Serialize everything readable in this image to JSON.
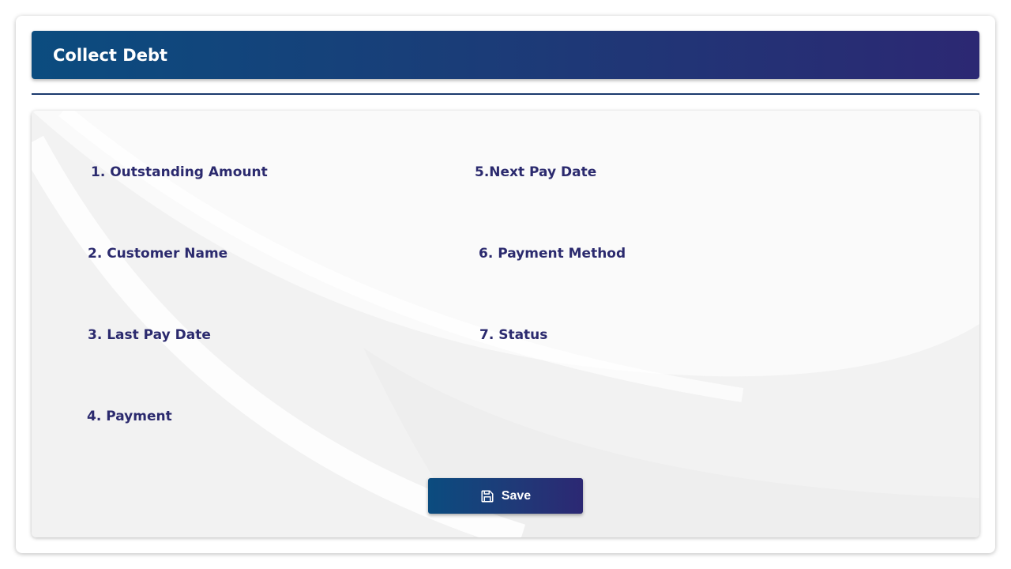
{
  "header": {
    "title": "Collect Debt"
  },
  "form": {
    "fields": [
      "1. Outstanding Amount",
      "2. Customer Name",
      "3. Last Pay Date",
      "4. Payment",
      "5.Next Pay Date",
      "6. Payment Method",
      "7. Status"
    ]
  },
  "actions": {
    "save_label": "Save",
    "save_icon": "floppy-disk-icon"
  },
  "colors": {
    "header_gradient_start": "#0b4c7f",
    "header_gradient_end": "#2c2873",
    "label_text": "#2b2a6e",
    "divider": "#1b3a6e"
  }
}
